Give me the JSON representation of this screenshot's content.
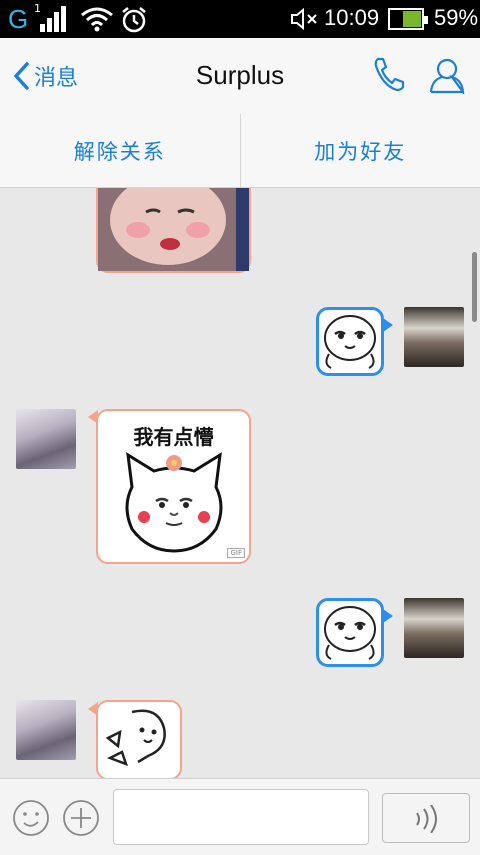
{
  "status": {
    "network": "G",
    "sim": "1",
    "time": "10:09",
    "battery": "59%",
    "battery_level": 0.59
  },
  "header": {
    "back_label": "消息",
    "title": "Surplus"
  },
  "actions": {
    "remove_label": "解除关系",
    "add_friend_label": "加为好友"
  },
  "messages": [
    {
      "side": "left",
      "type": "sticker",
      "text": ""
    },
    {
      "side": "right",
      "type": "sticker",
      "text": ""
    },
    {
      "side": "left",
      "type": "sticker",
      "text": "我有点懵",
      "badge": "GIF"
    },
    {
      "side": "right",
      "type": "sticker",
      "text": ""
    },
    {
      "side": "left",
      "type": "sticker",
      "text": ""
    }
  ],
  "colors": {
    "accent": "#1a7fd8",
    "own_bubble_border": "#2d8ef0",
    "other_bubble_border": "#f2a48c"
  }
}
